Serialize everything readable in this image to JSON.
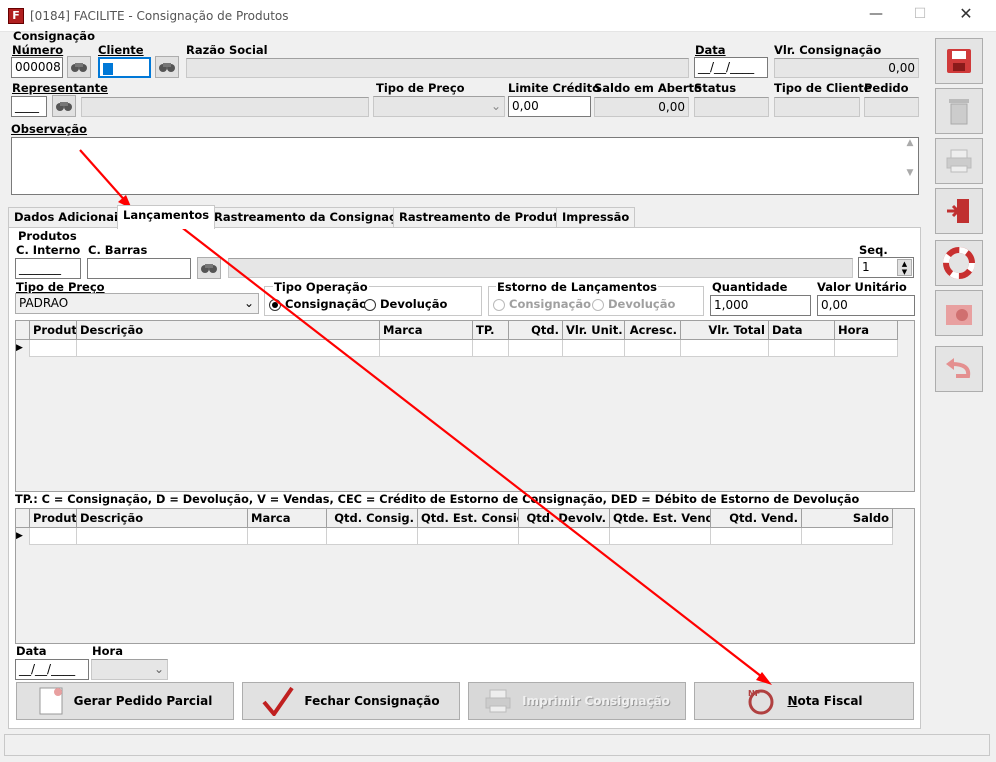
{
  "window": {
    "title": "[0184] FACILITE - Consignação de Produtos"
  },
  "header": {
    "group_label": "Consignação",
    "numero_label": "Número",
    "numero_value": "000008",
    "cliente_label": "Cliente",
    "cliente_value": "",
    "razao_label": "Razão Social",
    "data_label": "Data",
    "data_value": "__/__/____",
    "vlr_label": "Vlr. Consignação",
    "vlr_value": "0,00",
    "representante_label": "Representante",
    "representante_value": "____",
    "tipo_preco_label": "Tipo de Preço",
    "limite_label": "Limite Crédito",
    "limite_value": "0,00",
    "saldo_label": "Saldo em Aberto",
    "saldo_value": "0,00",
    "status_label": "Status",
    "tipo_cliente_label": "Tipo de Cliente",
    "pedido_label": "Pedido",
    "obs_label": "Observação"
  },
  "tabs": [
    "Dados Adicionais",
    "Lançamentos",
    "Rastreamento da Consignação",
    "Rastreamento de Produtos",
    "Impressão"
  ],
  "produtos": {
    "group_label": "Produtos",
    "c_interno_label": "C. Interno",
    "c_interno_value": "_______",
    "c_barras_label": "C. Barras",
    "seq_label": "Seq.",
    "seq_value": "1",
    "tipo_preco_label": "Tipo de Preço",
    "tipo_preco_value": "PADRAO",
    "tipo_op_label": "Tipo Operação",
    "op_consig": "Consignação",
    "op_devol": "Devolução",
    "estorno_label": "Estorno de Lançamentos",
    "est_consig": "Consignação",
    "est_devol": "Devolução",
    "qtd_label": "Quantidade",
    "qtd_value": "1,000",
    "vu_label": "Valor Unitário",
    "vu_value": "0,00"
  },
  "grid1": {
    "columns": [
      "Produto",
      "Descrição",
      "Marca",
      "TP.",
      "Qtd.",
      "Vlr. Unit.",
      "Acresc.",
      "Vlr. Total",
      "Data",
      "Hora"
    ]
  },
  "legend": "TP.: C = Consignação, D = Devolução, V = Vendas, CEC = Crédito de Estorno de Consignação, DED = Débito de Estorno de Devolução",
  "grid2": {
    "columns": [
      "Produto",
      "Descrição",
      "Marca",
      "Qtd. Consig.",
      "Qtd. Est. Consig.",
      "Qtd. Devolv.",
      "Qtde. Est. Venda",
      "Qtd. Vend.",
      "Saldo"
    ]
  },
  "footer": {
    "data_label": "Data",
    "data_value": "__/__/____",
    "hora_label": "Hora",
    "btn_gerar": "Gerar Pedido Parcial",
    "btn_fechar": "Fechar Consignação",
    "btn_imprimir": "Imprimir Consignação",
    "btn_nota_prefix": "N",
    "btn_nota_rest": "ota Fiscal"
  },
  "side_buttons": [
    "save-icon",
    "trash-icon",
    "printer-icon",
    "exit-door-icon",
    "lifebuoy-icon",
    "settings-folder-icon",
    "undo-icon"
  ],
  "colors": {
    "annotation": "#ff0000",
    "selected_field": "#0078d7"
  }
}
